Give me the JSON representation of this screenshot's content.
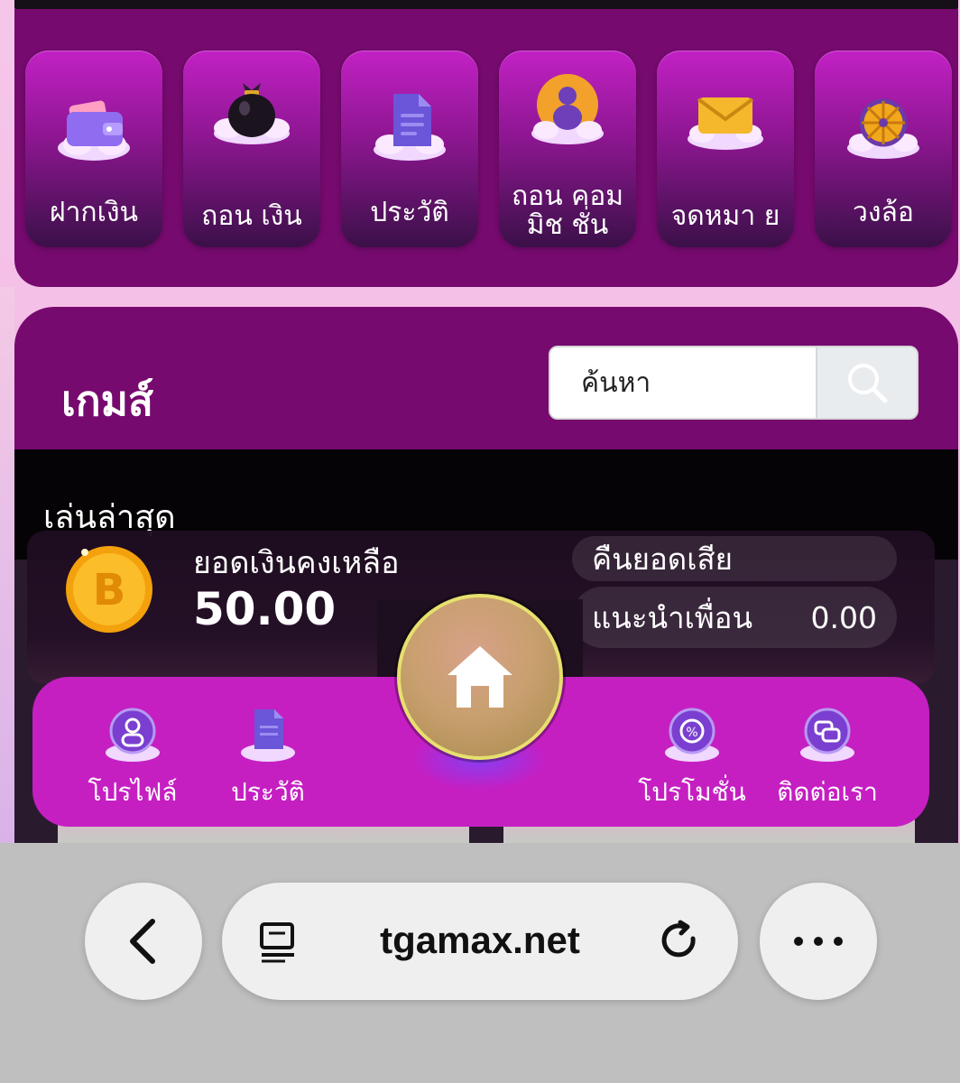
{
  "menu": {
    "items": [
      {
        "label": "ฝากเงิน",
        "icon": "wallet-icon"
      },
      {
        "label": "ถอน เงิน",
        "icon": "money-bag-icon"
      },
      {
        "label": "ประวัติ",
        "icon": "document-icon"
      },
      {
        "label": "ถอน คอมมิช ชั่น",
        "icon": "commission-icon"
      },
      {
        "label": "จดหมา ย",
        "icon": "envelope-icon"
      },
      {
        "label": "วงล้อ",
        "icon": "wheel-icon"
      }
    ]
  },
  "games": {
    "title": "เกมส์",
    "search_placeholder": "ค้นหา",
    "recent_label": "เล่นล่าสุด"
  },
  "balance": {
    "label": "ยอดเงินคงเหลือ",
    "value": "50.00",
    "cashback_label": "คืนยอดเสีย",
    "referral_label": "แนะนำเพื่อน",
    "referral_value": "0.00"
  },
  "bottom_nav": {
    "profile": "โปรไฟล์",
    "history": "ประวัติ",
    "promotion": "โปรโมชั่น",
    "contact": "ติดต่อเรา"
  },
  "browser": {
    "url": "tgamax.net"
  },
  "colors": {
    "panel": "#760a6f",
    "nav": "#c51fc2",
    "tile_top": "#c221c4",
    "coin": "#f5a70f"
  }
}
